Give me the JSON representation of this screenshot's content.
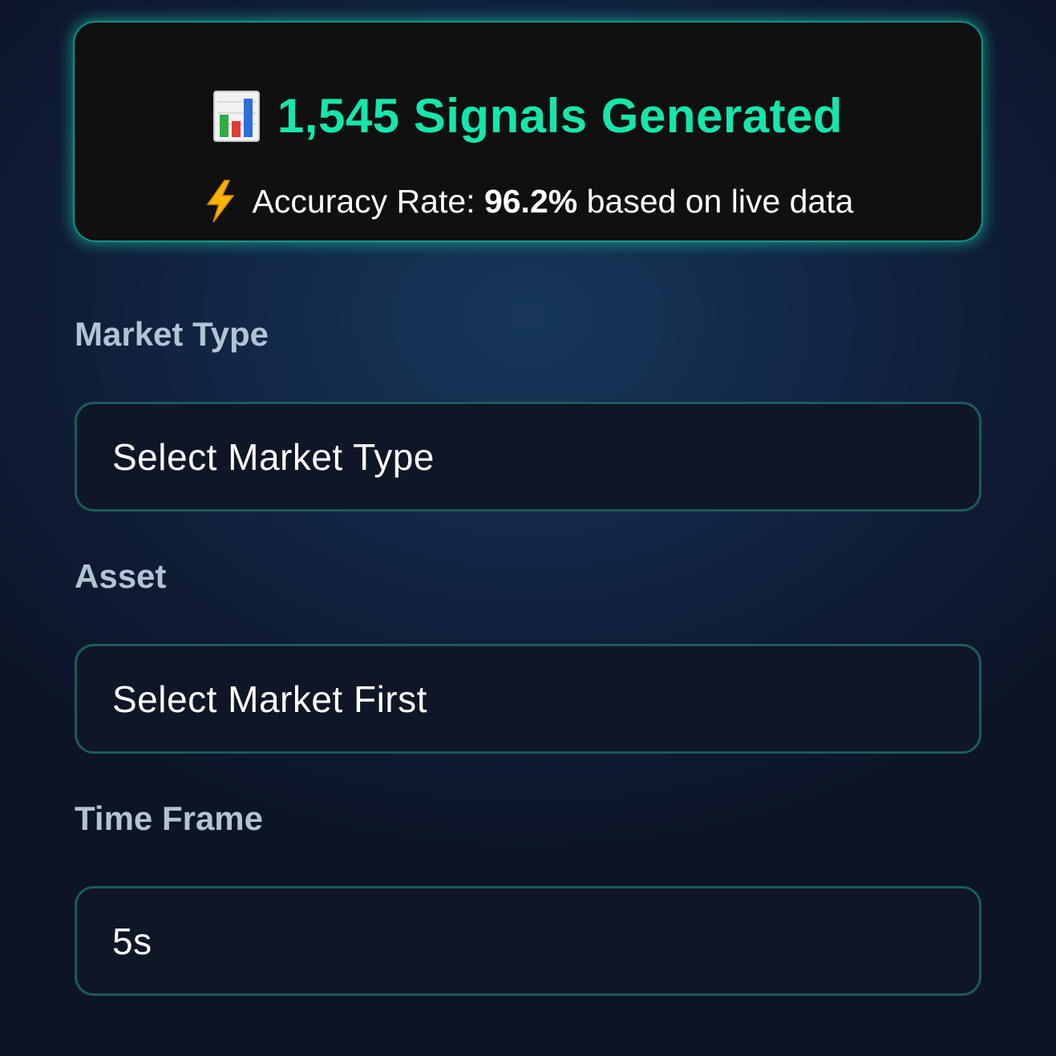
{
  "stats": {
    "signals_title": "1,545 Signals Generated",
    "accuracy_prefix": "Accuracy Rate:",
    "accuracy_value": "96.2%",
    "accuracy_suffix": "based on live data",
    "icons": [
      "bar-chart-icon",
      "lightning-bolt-icon"
    ],
    "accent_color": "#16e6ab"
  },
  "form": {
    "market_type": {
      "label": "Market Type",
      "value": "Select Market Type"
    },
    "asset": {
      "label": "Asset",
      "value": "Select Market First"
    },
    "time_frame": {
      "label": "Time Frame",
      "value": "5s"
    }
  }
}
